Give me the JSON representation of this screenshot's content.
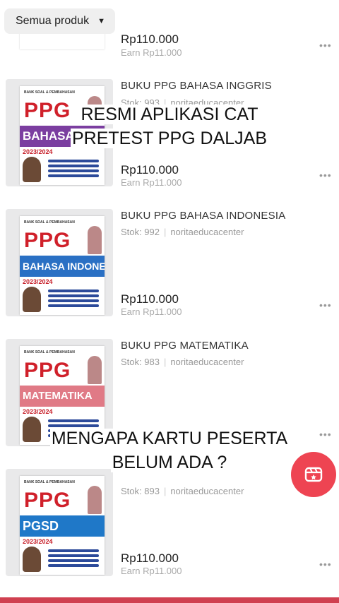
{
  "filter": {
    "label": "Semua produk"
  },
  "overlays": {
    "top": [
      "RESMI APLIKASI CAT",
      "PRETEST PPG DALJAB"
    ],
    "bottom": [
      "MENGAPA KARTU PESERTA",
      "BELUM ADA ?"
    ]
  },
  "products": [
    {
      "title": "",
      "stock": "",
      "seller": "",
      "price": "Rp110.000",
      "earn": "Earn Rp11.000",
      "cover_band": "",
      "band_color": "#7b3ea0"
    },
    {
      "title": "BUKU PPG BAHASA INGGRIS",
      "stock": "Stok: 993",
      "seller": "noritaeducacenter",
      "price": "Rp110.000",
      "earn": "Earn Rp11.000",
      "cover_band": "BAHASA INGGRIS",
      "band_color": "#7b3ea0",
      "cover_year": "2023/2024"
    },
    {
      "title": "BUKU PPG BAHASA INDONESIA",
      "stock": "Stok: 992",
      "seller": "noritaeducacenter",
      "price": "Rp110.000",
      "earn": "Earn Rp11.000",
      "cover_band": "BAHASA INDONESIA",
      "band_color": "#2a70c4",
      "cover_year": "2023/2024"
    },
    {
      "title": "BUKU PPG MATEMATIKA",
      "stock": "Stok: 983",
      "seller": "noritaeducacenter",
      "price": "",
      "earn": "",
      "cover_band": "MATEMATIKA",
      "band_color": "#e07a86",
      "cover_year": "2023/2024"
    },
    {
      "title": "",
      "stock": "Stok: 893",
      "seller": "noritaeducacenter",
      "price": "Rp110.000",
      "earn": "Earn Rp11.000",
      "cover_band": "PGSD",
      "band_color": "#1f78c8",
      "cover_year": "2023/2024"
    }
  ],
  "cover_common": {
    "top_text": "BANK SOAL & PEMBAHASAN",
    "logo": "PPG"
  },
  "more_icon": "more-horizontal-icon",
  "fab_icon": "clapperboard-icon"
}
